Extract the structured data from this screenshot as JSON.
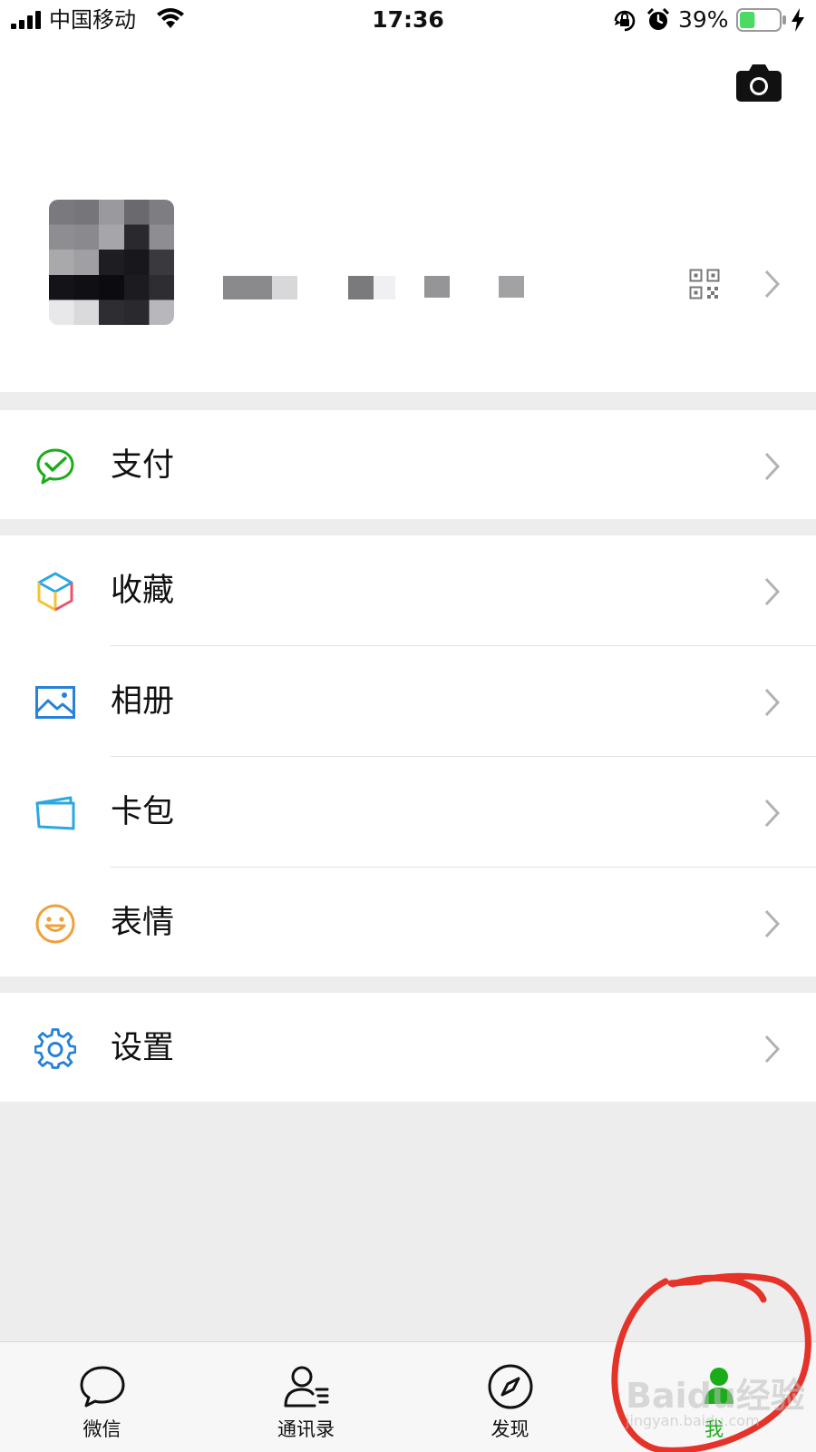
{
  "status_bar": {
    "carrier": "中国移动",
    "time": "17:36",
    "battery_percent": "39%",
    "battery_level": 0.39,
    "icons": [
      "signal-icon",
      "wifi-icon",
      "rotation-lock-icon",
      "alarm-icon",
      "battery-icon",
      "charging-icon"
    ]
  },
  "profile": {
    "camera_icon": "camera-icon",
    "qr_icon": "qr-code-icon",
    "avatar": "pixelated-avatar",
    "nickname": "pixelated-nickname"
  },
  "menu": {
    "pay": {
      "label": "支付",
      "icon": "wechat-pay-icon",
      "color": "#1aad19"
    },
    "favorites": {
      "label": "收藏",
      "icon": "favorites-cube-icon"
    },
    "album": {
      "label": "相册",
      "icon": "photo-album-icon",
      "color": "#2782d7"
    },
    "cards": {
      "label": "卡包",
      "icon": "card-wallet-icon",
      "color": "#2782d7"
    },
    "stickers": {
      "label": "表情",
      "icon": "smiley-icon",
      "color": "#f0a03c"
    },
    "settings": {
      "label": "设置",
      "icon": "gear-icon",
      "color": "#2782d7"
    }
  },
  "tabs": [
    {
      "label": "微信",
      "icon": "chat-bubble-icon"
    },
    {
      "label": "通讯录",
      "icon": "contacts-icon"
    },
    {
      "label": "发现",
      "icon": "compass-icon"
    },
    {
      "label": "我",
      "icon": "me-person-icon",
      "active": true
    }
  ],
  "colors": {
    "accent": "#1aad19",
    "annotation": "#e5332a",
    "background": "#ededed"
  },
  "watermark": {
    "text": "Baidu经验",
    "url": "jingyan.baidu.com"
  }
}
